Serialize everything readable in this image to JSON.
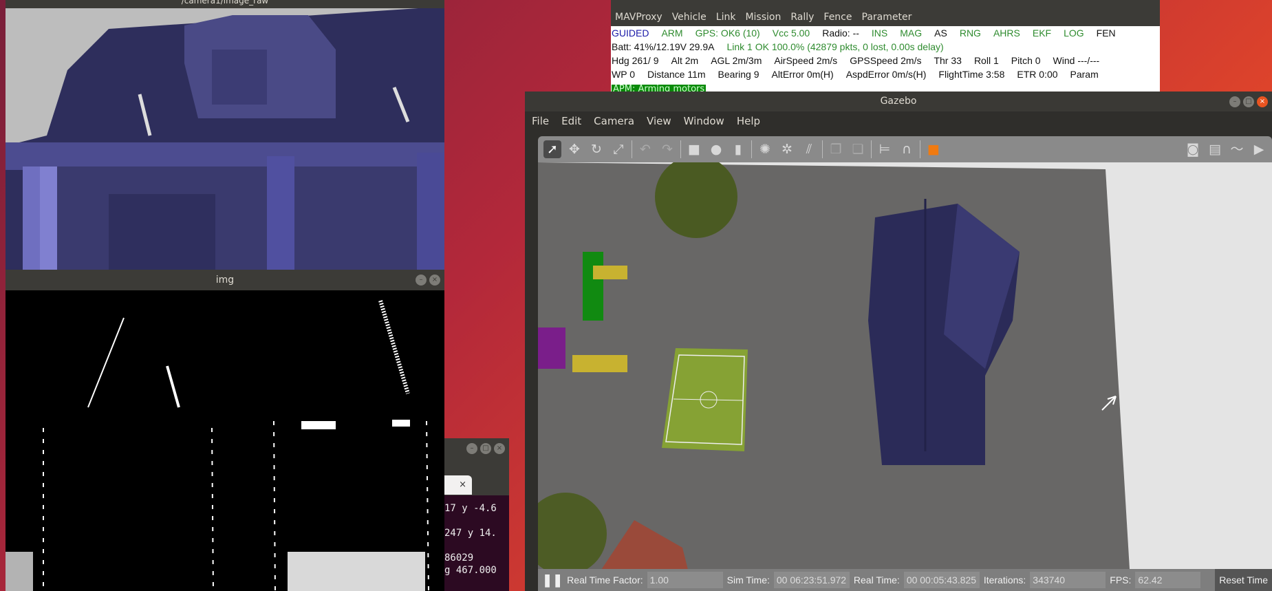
{
  "camera_window": {
    "title": "/camera1/image_raw"
  },
  "img_window": {
    "title": "img"
  },
  "console": {
    "menu": [
      "MAVProxy",
      "Vehicle",
      "Link",
      "Mission",
      "Rally",
      "Fence",
      "Parameter"
    ],
    "rows": [
      [
        {
          "t": "GUIDED",
          "c": "b"
        },
        {
          "t": "ARM",
          "c": "g"
        },
        {
          "t": "GPS: OK6 (10)",
          "c": "g"
        },
        {
          "t": "Vcc 5.00",
          "c": "g"
        },
        {
          "t": "Radio: --",
          "c": "k"
        },
        {
          "t": "INS",
          "c": "g"
        },
        {
          "t": "MAG",
          "c": "g"
        },
        {
          "t": "AS",
          "c": "k"
        },
        {
          "t": "RNG",
          "c": "g"
        },
        {
          "t": "AHRS",
          "c": "g"
        },
        {
          "t": "EKF",
          "c": "g"
        },
        {
          "t": "LOG",
          "c": "g"
        },
        {
          "t": "FEN",
          "c": "k"
        }
      ],
      [
        {
          "t": "Batt: 41%/12.19V 29.9A",
          "c": "k"
        },
        {
          "t": "Link 1 OK 100.0% (42879 pkts, 0 lost, 0.00s delay)",
          "c": "g"
        }
      ],
      [
        {
          "t": "Hdg 261/ 9",
          "c": "k"
        },
        {
          "t": "Alt 2m",
          "c": "k"
        },
        {
          "t": "AGL 2m/3m",
          "c": "k"
        },
        {
          "t": "AirSpeed 2m/s",
          "c": "k"
        },
        {
          "t": "GPSSpeed 2m/s",
          "c": "k"
        },
        {
          "t": "Thr 33",
          "c": "k"
        },
        {
          "t": "Roll 1",
          "c": "k"
        },
        {
          "t": "Pitch 0",
          "c": "k"
        },
        {
          "t": "Wind ---/---",
          "c": "k"
        }
      ],
      [
        {
          "t": "WP 0",
          "c": "k"
        },
        {
          "t": "Distance 11m",
          "c": "k"
        },
        {
          "t": "Bearing 9",
          "c": "k"
        },
        {
          "t": "AltError 0m(H)",
          "c": "k"
        },
        {
          "t": "AspdError 0m/s(H)",
          "c": "k"
        },
        {
          "t": "FlightTime 3:58",
          "c": "k"
        },
        {
          "t": "ETR 0:00",
          "c": "k"
        },
        {
          "t": "Param",
          "c": "k"
        }
      ]
    ],
    "message": "APM: Arming motors"
  },
  "gazebo": {
    "title": "Gazebo",
    "menu": [
      "File",
      "Edit",
      "Camera",
      "View",
      "Window",
      "Help"
    ],
    "toolbar_icons": [
      "select-arrow",
      "translate",
      "rotate",
      "scale",
      "undo",
      "redo",
      "box",
      "sphere",
      "cylinder",
      "point-light",
      "spot-light",
      "directional-light",
      "copy",
      "paste",
      "align",
      "snap",
      "color-shape"
    ],
    "toolbar_right_icons": [
      "screenshot",
      "log",
      "plot",
      "record-video"
    ],
    "status": {
      "rtf_label": "Real Time Factor:",
      "rtf": "1.00",
      "sim_label": "Sim Time:",
      "sim": "00 06:23:51.972",
      "real_label": "Real Time:",
      "real": "00 00:05:43.825",
      "iter_label": "Iterations:",
      "iter": "343740",
      "fps_label": "FPS:",
      "fps": "62.42",
      "reset": "Reset Time"
    }
  },
  "terminal": {
    "tab_close": "×",
    "lines": [
      "17 y -4.6",
      "",
      "247 y 14.",
      "",
      "86029",
      "g 467.000"
    ]
  }
}
